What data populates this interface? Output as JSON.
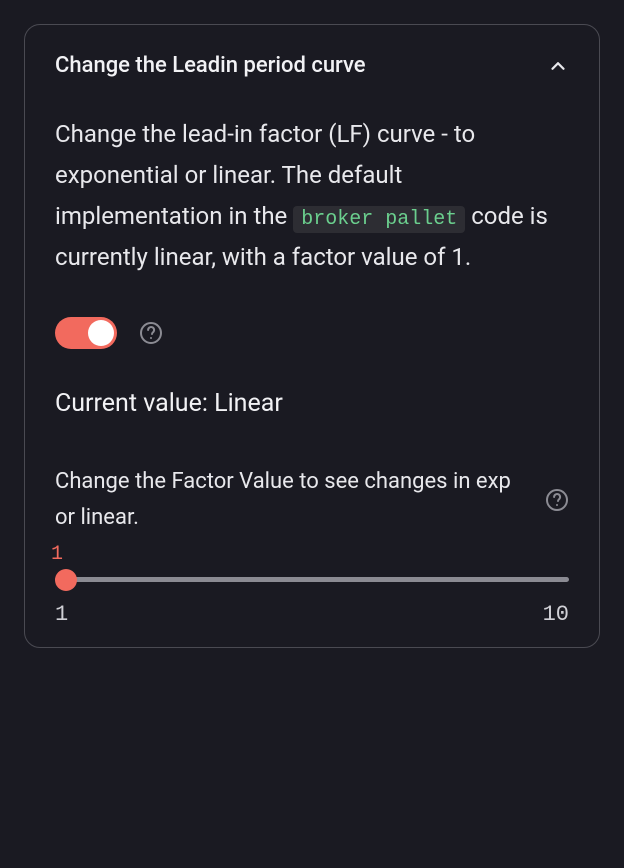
{
  "header": {
    "title": "Change the Leadin period curve"
  },
  "description": {
    "text_before": "Change the lead-in factor (LF) curve - to exponential or linear. The default implementation in the ",
    "code": "broker pallet",
    "text_after": " code is currently linear, with a factor value of 1."
  },
  "toggle": {
    "on": true
  },
  "current_value": {
    "prefix": "Current value: ",
    "mode": "Linear"
  },
  "factor": {
    "label": "Change the Factor Value to see changes in exp or linear.",
    "value": 1,
    "min": 1,
    "max": 10
  },
  "colors": {
    "accent": "#f26a5e",
    "code_text": "#6bcf8e",
    "panel_bg": "#1a1a22"
  }
}
